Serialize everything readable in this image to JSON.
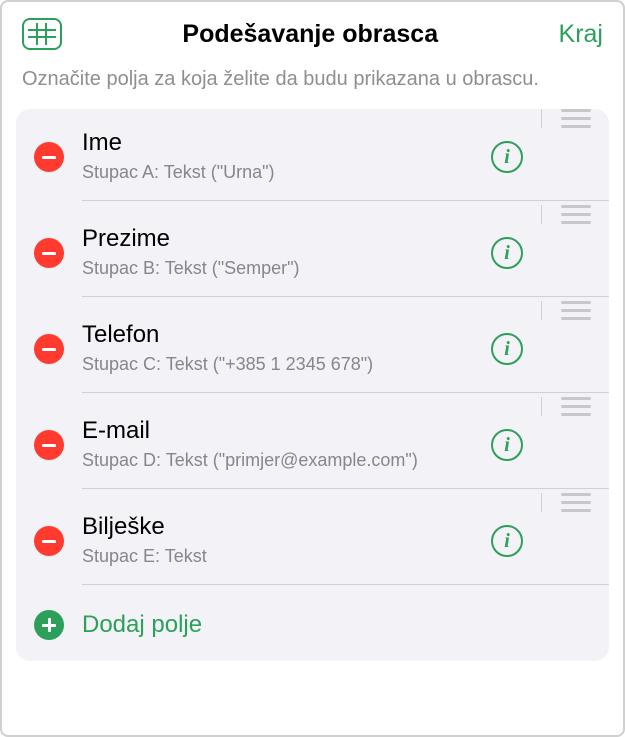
{
  "header": {
    "title": "Podešavanje obrasca",
    "done_label": "Kraj"
  },
  "subtitle": "Označite polja za koja želite da budu prikazana u obrascu.",
  "fields": [
    {
      "title": "Ime",
      "subtitle": "Stupac A: Tekst (\"Urna\")"
    },
    {
      "title": "Prezime",
      "subtitle": "Stupac B: Tekst (\"Semper\")"
    },
    {
      "title": "Telefon",
      "subtitle": "Stupac C: Tekst (\"+385 1 2345 678\")"
    },
    {
      "title": "E-mail",
      "subtitle": "Stupac D: Tekst (\"primjer@example.com\")"
    },
    {
      "title": "Bilješke",
      "subtitle": "Stupac E: Tekst"
    }
  ],
  "add_field_label": "Dodaj polje",
  "info_glyph": "i"
}
